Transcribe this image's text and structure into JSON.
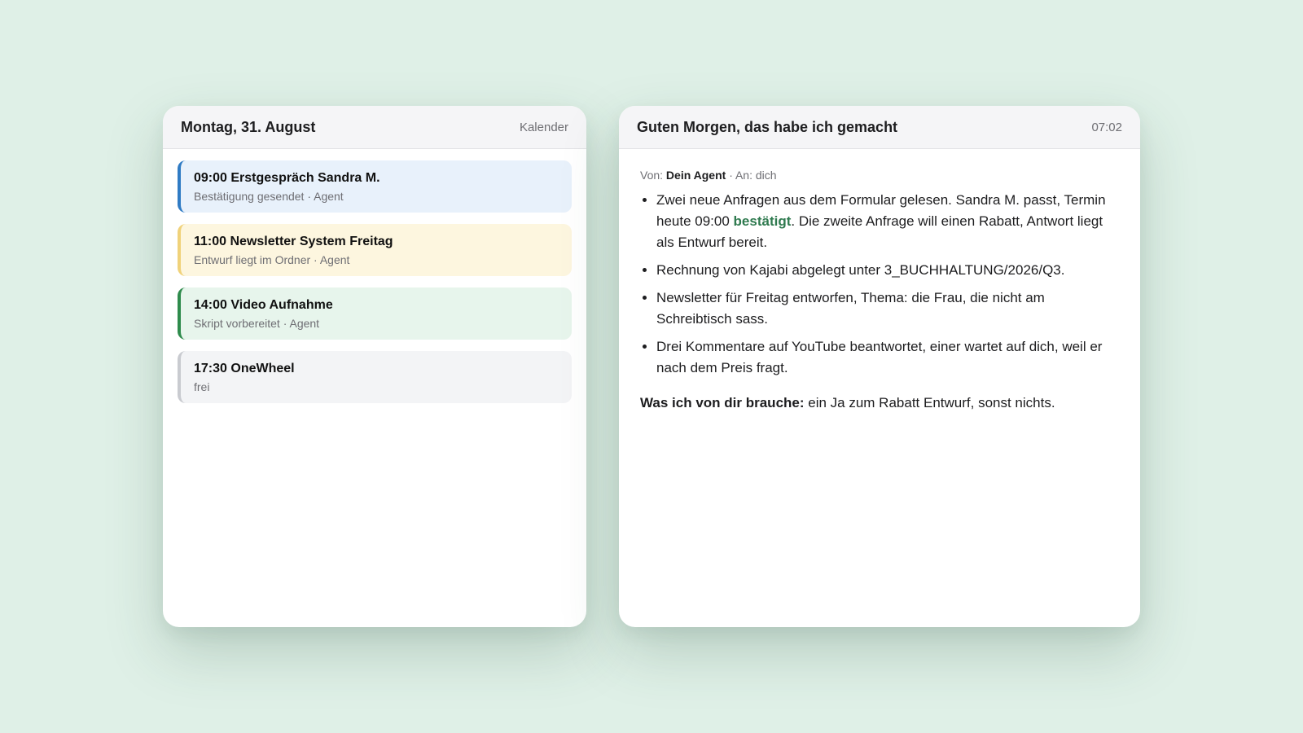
{
  "calendar": {
    "title": "Montag, 31. August",
    "label": "Kalender",
    "events": [
      {
        "title": "09:00 Erstgespräch Sandra M.",
        "subtitle": "Bestätigung gesendet · Agent",
        "bg": "#e8f1fb",
        "accent": "#2f7bc4"
      },
      {
        "title": "11:00 Newsletter System Freitag",
        "subtitle": "Entwurf liegt im Ordner · Agent",
        "bg": "#fdf6df",
        "accent": "#f0d27a"
      },
      {
        "title": "14:00 Video Aufnahme",
        "subtitle": "Skript vorbereitet · Agent",
        "bg": "#e7f5ec",
        "accent": "#2e8b4c"
      },
      {
        "title": "17:30 OneWheel",
        "subtitle": "frei",
        "bg": "#f3f4f6",
        "accent": "#c9cbd0"
      }
    ]
  },
  "message": {
    "title": "Guten Morgen, das habe ich gemacht",
    "time": "07:02",
    "from_label": "Von:",
    "from": "Dein Agent",
    "to": "· An: dich",
    "bullets": {
      "b1_pre": "Zwei neue Anfragen aus dem Formular gelesen. Sandra M. passt, Termin heute 09:00 ",
      "b1_highlight": "bestätigt",
      "b1_post": ". Die zweite Anfrage will einen Rabatt, Antwort liegt als Entwurf bereit.",
      "b2": "Rechnung von Kajabi abgelegt unter 3_BUCHHALTUNG/2026/Q3.",
      "b3": "Newsletter für Freitag entworfen, Thema: die Frau, die nicht am Schreibtisch sass.",
      "b4": "Drei Kommentare auf YouTube beantwortet, einer wartet auf dich, weil er nach dem Preis fragt."
    },
    "need_label": "Was ich von dir brauche:",
    "need_text": " ein Ja zum Rabatt Entwurf, sonst nichts."
  }
}
